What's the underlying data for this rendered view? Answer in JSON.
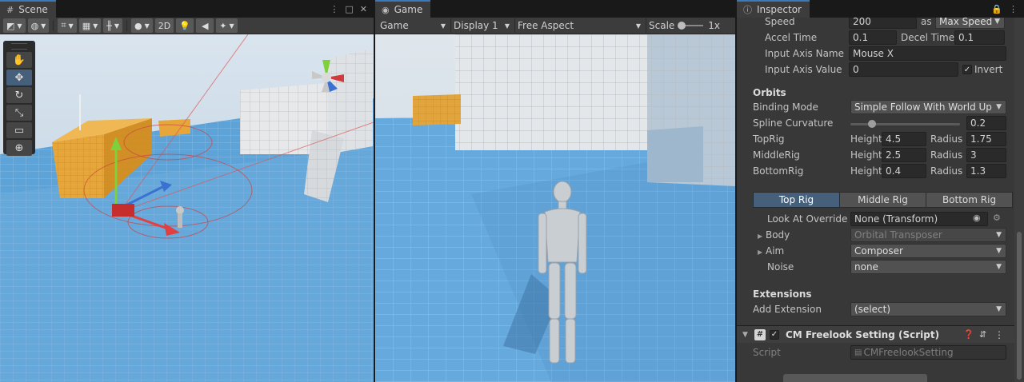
{
  "scene": {
    "tab_label": "Scene",
    "toolbar": {
      "mode_2d": "2D"
    },
    "tools": [
      "hand-tool-icon",
      "move-tool-icon",
      "rotate-tool-icon",
      "scale-tool-icon",
      "rect-tool-icon",
      "transform-tool-icon"
    ]
  },
  "game": {
    "tab_label": "Game",
    "mode": "Game",
    "display": "Display 1",
    "aspect": "Free Aspect",
    "scale_label": "Scale",
    "scale_value": "1x"
  },
  "inspector": {
    "tab_label": "Inspector",
    "speed": {
      "label": "Speed",
      "value": "200",
      "as_label": "as",
      "mode": "Max Speed"
    },
    "accel_time": {
      "label": "Accel Time",
      "value": "0.1"
    },
    "decel_time": {
      "label": "Decel Time",
      "value": "0.1"
    },
    "input_axis_name": {
      "label": "Input Axis Name",
      "value": "Mouse X"
    },
    "input_axis_value": {
      "label": "Input Axis Value",
      "value": "0",
      "invert_label": "Invert",
      "invert_checked": true
    },
    "orbits": {
      "title": "Orbits",
      "binding_mode_label": "Binding Mode",
      "binding_mode": "Simple Follow With World Up",
      "spline_label": "Spline Curvature",
      "spline_value": "0.2",
      "spline_fraction": 0.2,
      "height_label": "Height",
      "radius_label": "Radius",
      "rigs": [
        {
          "name": "TopRig",
          "height": "4.5",
          "radius": "1.75"
        },
        {
          "name": "MiddleRig",
          "height": "2.5",
          "radius": "3"
        },
        {
          "name": "BottomRig",
          "height": "0.4",
          "radius": "1.3"
        }
      ]
    },
    "rig_tabs": [
      "Top Rig",
      "Middle Rig",
      "Bottom Rig"
    ],
    "look_at_override": {
      "label": "Look At Override",
      "value": "None (Transform)"
    },
    "body": {
      "label": "Body",
      "value": "Orbital Transposer"
    },
    "aim": {
      "label": "Aim",
      "value": "Composer"
    },
    "noise": {
      "label": "Noise",
      "value": "none"
    },
    "extensions": {
      "title": "Extensions",
      "add_label": "Add Extension",
      "add_value": "(select)"
    },
    "component": {
      "title": "CM Freelook Setting (Script)",
      "script_label": "Script",
      "script_value": "CMFreelookSetting"
    }
  },
  "colors": {
    "accent": "#3a79bb",
    "selected_tab": "#46607c",
    "panel": "#383838"
  }
}
